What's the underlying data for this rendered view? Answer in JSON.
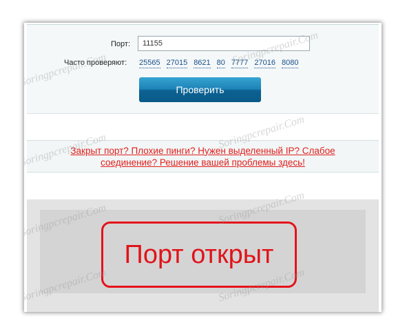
{
  "form": {
    "port_label": "Порт:",
    "port_value": "11155",
    "frequent_label": "Часто проверяют:",
    "frequent_ports": [
      "25565",
      "27015",
      "8621",
      "80",
      "7777",
      "27016",
      "8080"
    ],
    "check_button": "Проверить"
  },
  "promo": {
    "link_text": "Закрыт порт? Плохие пинги? Нужен выделенный IP? Слабое соединение? Решение вашей проблемы здесь!"
  },
  "result": {
    "status_text": "Порт открыт"
  },
  "watermark": {
    "text": "Soringpcrepair.Com"
  },
  "colors": {
    "accent_red": "#e0141a",
    "link_blue": "#1a4f8a",
    "button_blue": "#1d82b6"
  }
}
